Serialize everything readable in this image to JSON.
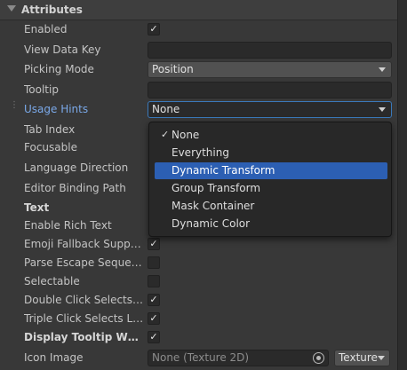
{
  "section": {
    "title": "Attributes"
  },
  "rows": {
    "enabled": {
      "label": "Enabled",
      "checked": true
    },
    "view_data_key": {
      "label": "View Data Key",
      "value": ""
    },
    "picking_mode": {
      "label": "Picking Mode",
      "value": "Position"
    },
    "tooltip": {
      "label": "Tooltip",
      "value": ""
    },
    "usage_hints": {
      "label": "Usage Hints",
      "value": "None"
    },
    "tab_index": {
      "label": "Tab Index"
    },
    "focusable": {
      "label": "Focusable"
    },
    "language_direction": {
      "label": "Language Direction"
    },
    "editor_binding_path": {
      "label": "Editor Binding Path"
    },
    "text": {
      "label": "Text"
    },
    "enable_rich_text": {
      "label": "Enable Rich Text"
    },
    "emoji_fallback": {
      "label": "Emoji Fallback Support",
      "checked": true
    },
    "parse_escape": {
      "label": "Parse Escape Sequen...",
      "checked": false
    },
    "selectable": {
      "label": "Selectable",
      "checked": false
    },
    "double_click": {
      "label": "Double Click Selects ...",
      "checked": true
    },
    "triple_click": {
      "label": "Triple Click Selects Li...",
      "checked": true
    },
    "display_tooltip": {
      "label": "Display Tooltip When...",
      "checked": true
    },
    "icon_image": {
      "label": "Icon Image",
      "value": "None (Texture 2D)",
      "type": "Texture"
    }
  },
  "usage_hints_menu": {
    "options": [
      {
        "label": "None",
        "checked": true,
        "highlighted": false
      },
      {
        "label": "Everything",
        "checked": false,
        "highlighted": false
      },
      {
        "label": "Dynamic Transform",
        "checked": false,
        "highlighted": true
      },
      {
        "label": "Group Transform",
        "checked": false,
        "highlighted": false
      },
      {
        "label": "Mask Container",
        "checked": false,
        "highlighted": false
      },
      {
        "label": "Dynamic Color",
        "checked": false,
        "highlighted": false
      }
    ],
    "check_glyph": "✓"
  },
  "icons": {
    "foldout": "foldout-expanded-icon",
    "dropdown": "chevron-down-icon",
    "checkbox": "checkmark-icon",
    "object_picker": "object-picker-icon",
    "drag_handle": "drag-handle-icon"
  },
  "colors": {
    "background": "#383838",
    "field": "#2a2a2a",
    "highlight": "#2c5fb3",
    "label_accent": "#7aa8e8",
    "focus_border": "#3a79bb"
  }
}
